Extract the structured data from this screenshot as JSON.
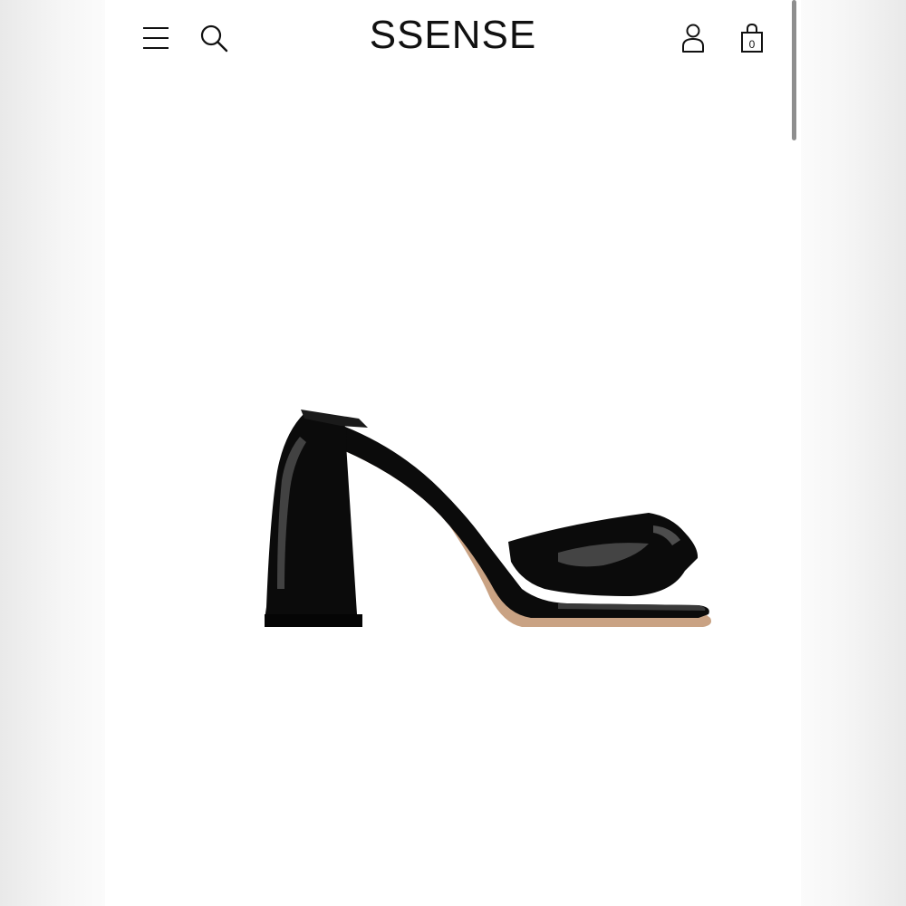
{
  "header": {
    "logo_text": "SSENSE",
    "menu_icon": "hamburger-menu-icon",
    "search_icon": "search-icon",
    "account_icon": "user-icon",
    "bag_icon": "shopping-bag-icon",
    "bag_count": "0"
  },
  "product": {
    "image_subject": "black-patent-mule-sandal",
    "colors": {
      "upper": "#0b0b0b",
      "sole": "#c9a283",
      "highlight": "#6a6a6a"
    }
  },
  "colors": {
    "background": "#ffffff",
    "text": "#111111",
    "scrollbar": "#8e8e8e"
  }
}
